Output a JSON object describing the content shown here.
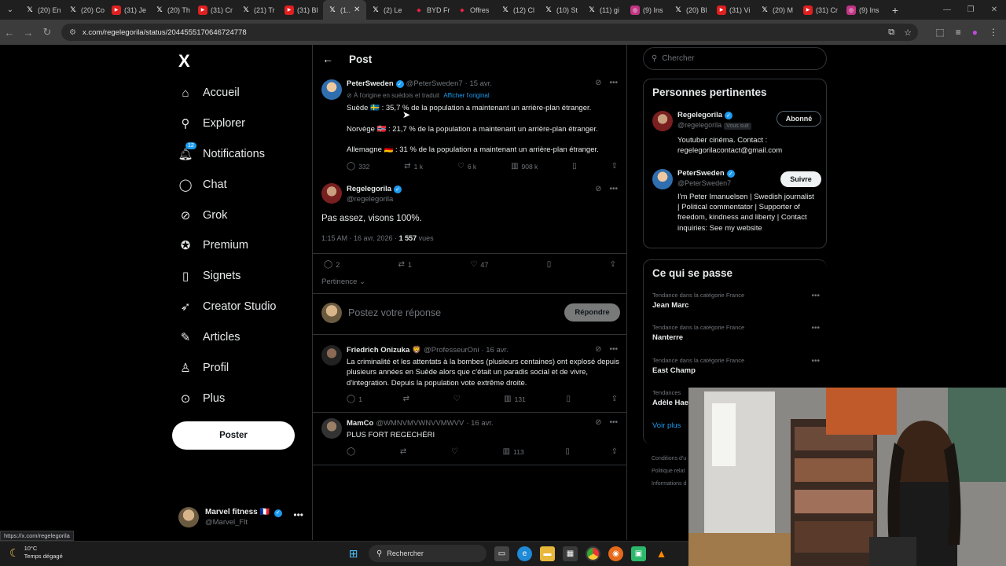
{
  "browser": {
    "tabs": [
      {
        "icon": "x",
        "title": "(20) En"
      },
      {
        "icon": "x",
        "title": "(20) Co"
      },
      {
        "icon": "yt",
        "title": "(31) Je"
      },
      {
        "icon": "x",
        "title": "(20) Th"
      },
      {
        "icon": "yt",
        "title": "(31) Cr"
      },
      {
        "icon": "x",
        "title": "(21) Tr"
      },
      {
        "icon": "yt",
        "title": "(31) Bl"
      },
      {
        "icon": "x",
        "title": "(1..",
        "active": true
      },
      {
        "icon": "x",
        "title": "(2) Le"
      },
      {
        "icon": "byd",
        "title": "BYD Fr"
      },
      {
        "icon": "byd",
        "title": "Offres"
      },
      {
        "icon": "x",
        "title": "(12) Cl"
      },
      {
        "icon": "x",
        "title": "(10) St"
      },
      {
        "icon": "x",
        "title": "(11) gi"
      },
      {
        "icon": "ig",
        "title": "(9) Ins"
      },
      {
        "icon": "x",
        "title": "(20) Bl"
      },
      {
        "icon": "yt",
        "title": "(31) Vi"
      },
      {
        "icon": "x",
        "title": "(20) M"
      },
      {
        "icon": "yt",
        "title": "(31) Cr"
      },
      {
        "icon": "ig",
        "title": "(9) Ins"
      }
    ],
    "url": "x.com/regelegorila/status/2044555170646724778",
    "hover_url": "https://x.com/regelegorila"
  },
  "nav": {
    "logo": "X",
    "items": [
      {
        "label": "Accueil",
        "icon": "home-icon",
        "glyph": "⌂"
      },
      {
        "label": "Explorer",
        "icon": "search-icon",
        "glyph": "⚲"
      },
      {
        "label": "Notifications",
        "icon": "bell-icon",
        "glyph": "🔔︎",
        "badge": "12"
      },
      {
        "label": "Chat",
        "icon": "chat-icon",
        "glyph": "◯"
      },
      {
        "label": "Grok",
        "icon": "grok-icon",
        "glyph": "⊘"
      },
      {
        "label": "Premium",
        "icon": "premium-icon",
        "glyph": "✪"
      },
      {
        "label": "Signets",
        "icon": "bookmark-icon",
        "glyph": "▯"
      },
      {
        "label": "Creator Studio",
        "icon": "rocket-icon",
        "glyph": "➶"
      },
      {
        "label": "Articles",
        "icon": "article-icon",
        "glyph": "✎"
      },
      {
        "label": "Profil",
        "icon": "profile-icon",
        "glyph": "♙"
      },
      {
        "label": "Plus",
        "icon": "more-icon",
        "glyph": "⊙"
      }
    ],
    "post_button": "Poster",
    "account": {
      "name": "Marvel fitness",
      "flag": "🇫🇷",
      "handle": "@Marvel_Flt"
    }
  },
  "main": {
    "header_title": "Post",
    "quoted": {
      "name": "PeterSweden",
      "handle": "@PeterSweden7",
      "date": "· 15 avr.",
      "translate_note": "À l'origine en suédois et traduit",
      "translate_link": "Afficher l'original",
      "lines": [
        "Suède 🇸🇪 : 35,7 % de la population a maintenant un arrière-plan étranger.",
        "Norvège 🇳🇴 : 21,7 % de la population a maintenant un arrière-plan étranger.",
        "Allemagne 🇩🇪 : 31 % de la population a maintenant un arrière-plan étranger."
      ],
      "stats": {
        "replies": "332",
        "reposts": "1 k",
        "likes": "6 k",
        "views": "908 k"
      }
    },
    "focus": {
      "name": "Regelegorila",
      "handle": "@regelegorila",
      "text": "Pas assez, visons 100%.",
      "time": "1:15 AM · 16 avr. 2026 · ",
      "views": "1 557",
      "views_label": " vues",
      "stats": {
        "replies": "2",
        "reposts": "1",
        "likes": "47"
      }
    },
    "sort_label": "Pertinence",
    "reply_placeholder": "Postez votre réponse",
    "reply_button": "Répondre",
    "replies": [
      {
        "name": "Friedrich Onizuka",
        "emoji": "🦁",
        "handle": "@ProfesseurOni",
        "date": "· 16 avr.",
        "text": "La criminalité et les attentats à la bombes (plusieurs centaines) ont explosé depuis plusieurs années en Suède alors que c'était un paradis social et de vivre, d'integration. Depuis la population vote extrême droite.",
        "replies": "1",
        "reposts": "",
        "likes": "",
        "views": "131"
      },
      {
        "name": "MamCo",
        "emoji": "",
        "handle": "@WMNVMVWNVVMWVV",
        "date": "· 16 avr.",
        "text": "PLUS FORT REGECHÉRI",
        "replies": "",
        "reposts": "",
        "likes": "",
        "views": "113"
      }
    ]
  },
  "right": {
    "search_placeholder": "Chercher",
    "people_title": "Personnes pertinentes",
    "people": [
      {
        "name": "Regelegorila",
        "handle": "@regelegorila",
        "follows_you": "Vous suit",
        "button": "Abonné",
        "bio": "Youtuber cinéma. Contact : regelegorilacontact@gmail.com"
      },
      {
        "name": "PeterSweden",
        "handle": "@PeterSweden7",
        "follows_you": "",
        "button": "Suivre",
        "bio": "I'm Peter Imanuelsen | Swedish journalist | Political commentator | Supporter of freedom, kindness and liberty | Contact inquiries: See my website"
      }
    ],
    "trends_title": "Ce qui se passe",
    "trends": [
      {
        "category": "Tendance dans la catégorie France",
        "name": "Jean Marc"
      },
      {
        "category": "Tendance dans la catégorie France",
        "name": "Nanterre"
      },
      {
        "category": "Tendance dans la catégorie France",
        "name": "East Champ"
      },
      {
        "category": "Tendances",
        "name": "Adèle Hae"
      }
    ],
    "see_more": "Voir plus",
    "footer": [
      "Conditions d'u",
      "Politique relat",
      "Informations d"
    ]
  },
  "taskbar": {
    "temp": "10°C",
    "weather": "Temps dégagé",
    "search": "Rechercher"
  },
  "colors": {
    "accent": "#1d9bf0",
    "background": "#000000",
    "border": "#2f3336",
    "muted": "#71767b"
  }
}
